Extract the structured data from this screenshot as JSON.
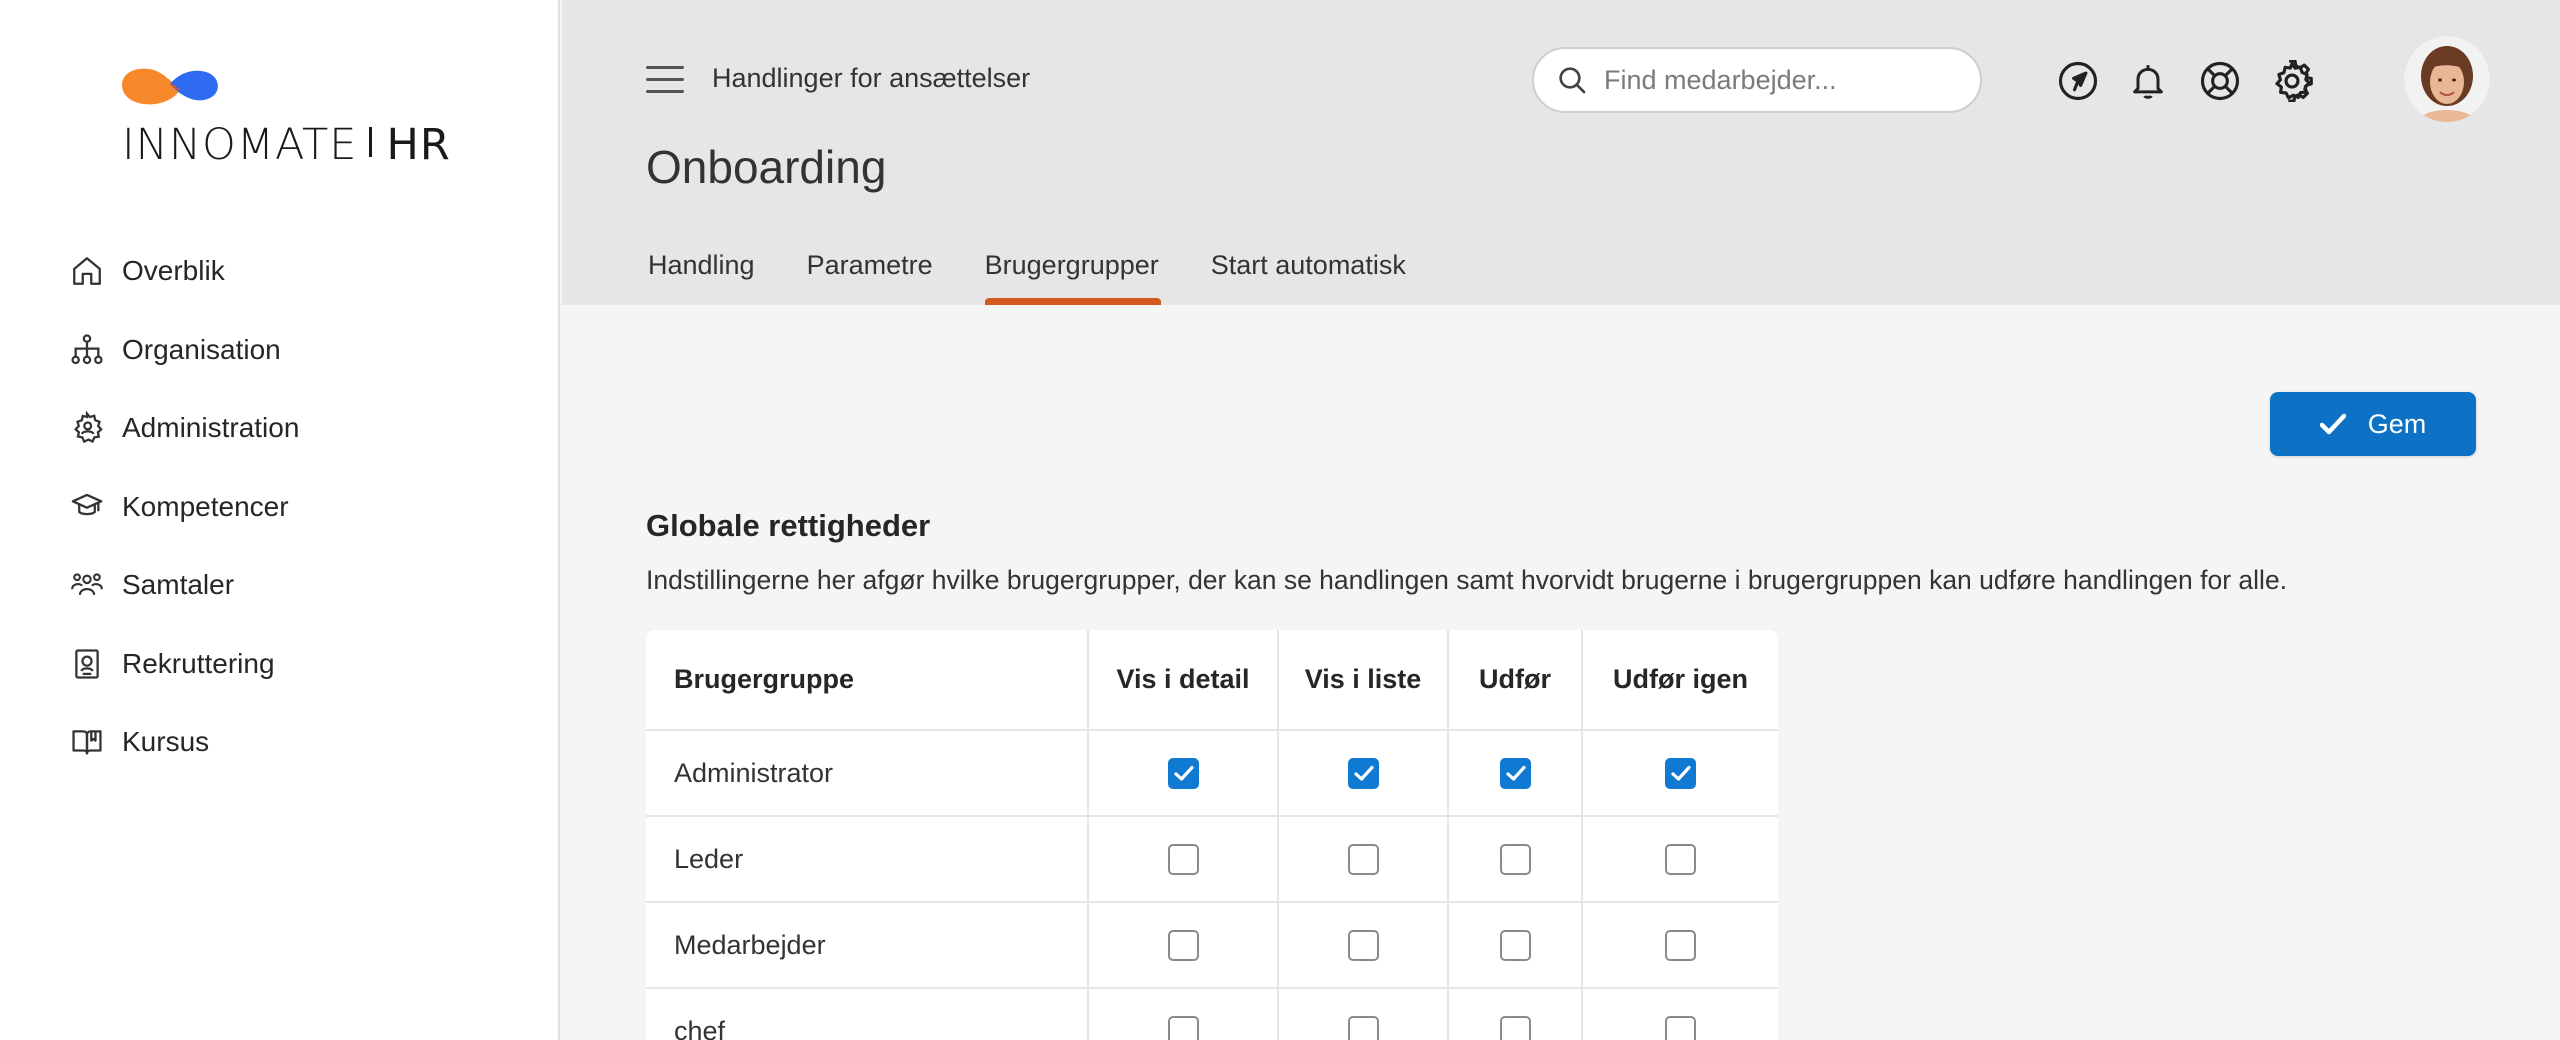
{
  "brand": {
    "name_light": "INNOMATE",
    "name_bold": "HR",
    "colors": {
      "orange": "#f7892a",
      "blue": "#2f6bf0"
    }
  },
  "sidebar": {
    "items": [
      {
        "label": "Overblik",
        "icon": "home-icon"
      },
      {
        "label": "Organisation",
        "icon": "org-chart-icon"
      },
      {
        "label": "Administration",
        "icon": "gear-person-icon"
      },
      {
        "label": "Kompetencer",
        "icon": "graduation-cap-icon"
      },
      {
        "label": "Samtaler",
        "icon": "people-group-icon"
      },
      {
        "label": "Rekruttering",
        "icon": "id-badge-icon"
      },
      {
        "label": "Kursus",
        "icon": "book-icon"
      }
    ]
  },
  "header": {
    "section_title": "Handlinger for ansættelser",
    "search_placeholder": "Find medarbejder...",
    "icons": [
      "navigate-icon",
      "bell-icon",
      "lifebuoy-icon",
      "gear-icon"
    ]
  },
  "page": {
    "title": "Onboarding",
    "tabs": [
      {
        "label": "Handling",
        "active": false
      },
      {
        "label": "Parametre",
        "active": false
      },
      {
        "label": "Brugergrupper",
        "active": true
      },
      {
        "label": "Start automatisk",
        "active": false
      }
    ],
    "accent": "#d25a1c"
  },
  "toolbar": {
    "save_label": "Gem",
    "save_color": "#0d71c6"
  },
  "permissions": {
    "heading": "Globale rettigheder",
    "description": "Indstillingerne her afgør hvilke brugergrupper, der kan se handlingen samt hvorvidt brugerne i brugergruppen kan udføre handlingen for alle.",
    "columns": [
      "Brugergruppe",
      "Vis i detail",
      "Vis i liste",
      "Udfør",
      "Udfør igen"
    ],
    "rows": [
      {
        "group": "Administrator",
        "values": [
          true,
          true,
          true,
          true
        ]
      },
      {
        "group": "Leder",
        "values": [
          false,
          false,
          false,
          false
        ]
      },
      {
        "group": "Medarbejder",
        "values": [
          false,
          false,
          false,
          false
        ]
      },
      {
        "group": "chef",
        "values": [
          false,
          false,
          false,
          false
        ]
      }
    ]
  }
}
